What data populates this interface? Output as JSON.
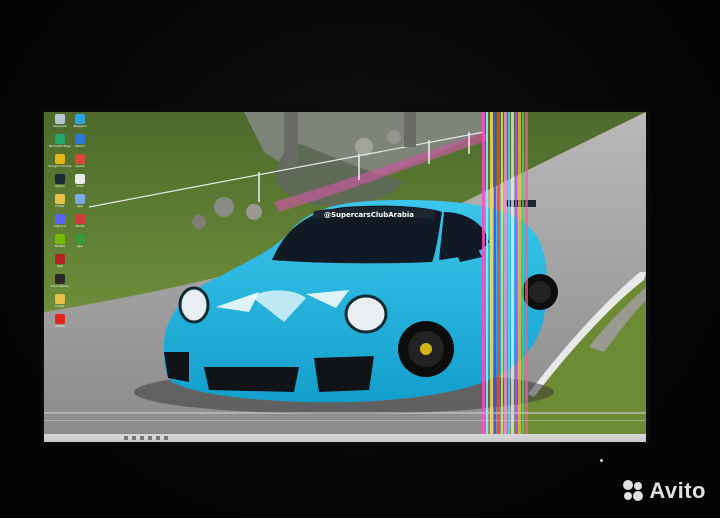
{
  "scene": {
    "description_type": "photo-of-monitor",
    "bezel_color": "#0b0b0b",
    "background_color": "#050505"
  },
  "wallpaper": {
    "car_color": "#27b6e0",
    "windshield_banner": "@SupercarsClubArabia",
    "road_color": "#8f8f8f",
    "grass_color": "#5b7a2c"
  },
  "desktop": {
    "icons": [
      {
        "name": "recycle-bin-icon",
        "label": "Корзина",
        "color": "#b7c4d1"
      },
      {
        "name": "telegram-icon",
        "label": "Telegram",
        "color": "#2aa3e0"
      },
      {
        "name": "edge-icon",
        "label": "Microsoft Edge",
        "color": "#1fa86a"
      },
      {
        "name": "steam-blue-icon",
        "label": "Steam",
        "color": "#2d7bd6"
      },
      {
        "name": "chrome-icon",
        "label": "Google Chrome",
        "color": "#e5b619"
      },
      {
        "name": "game-icon",
        "label": "Game",
        "color": "#d9473a"
      },
      {
        "name": "steam-icon",
        "label": "Steam",
        "color": "#1b2838"
      },
      {
        "name": "chart-icon",
        "label": "Stats",
        "color": "#eaeaea"
      },
      {
        "name": "folder-icon",
        "label": "Folder",
        "color": "#e6c04a"
      },
      {
        "name": "app-icon",
        "label": "App",
        "color": "#7aa7e8"
      },
      {
        "name": "discord-icon",
        "label": "Discord",
        "color": "#5865f2"
      },
      {
        "name": "media-icon",
        "label": "Media",
        "color": "#d43b3b"
      },
      {
        "name": "nvidia-icon",
        "label": "NVIDIA",
        "color": "#76b900"
      },
      {
        "name": "green-app-icon",
        "label": "App",
        "color": "#3a9a3a"
      },
      {
        "name": "red-app-icon",
        "label": "App",
        "color": "#b22222"
      },
      {
        "name": "empty-slot",
        "label": "",
        "color": "transparent"
      },
      {
        "name": "epic-icon",
        "label": "Epic Games",
        "color": "#2a2a2a"
      },
      {
        "name": "empty-slot-2",
        "label": "",
        "color": "transparent"
      },
      {
        "name": "folder-2-icon",
        "label": "Folder",
        "color": "#e6c04a"
      },
      {
        "name": "empty-slot-3",
        "label": "",
        "color": "transparent"
      },
      {
        "name": "adobe-icon",
        "label": "Adobe",
        "color": "#e1251b"
      },
      {
        "name": "empty-slot-4",
        "label": "",
        "color": "transparent"
      }
    ]
  },
  "watermark": {
    "text": "Avito"
  }
}
